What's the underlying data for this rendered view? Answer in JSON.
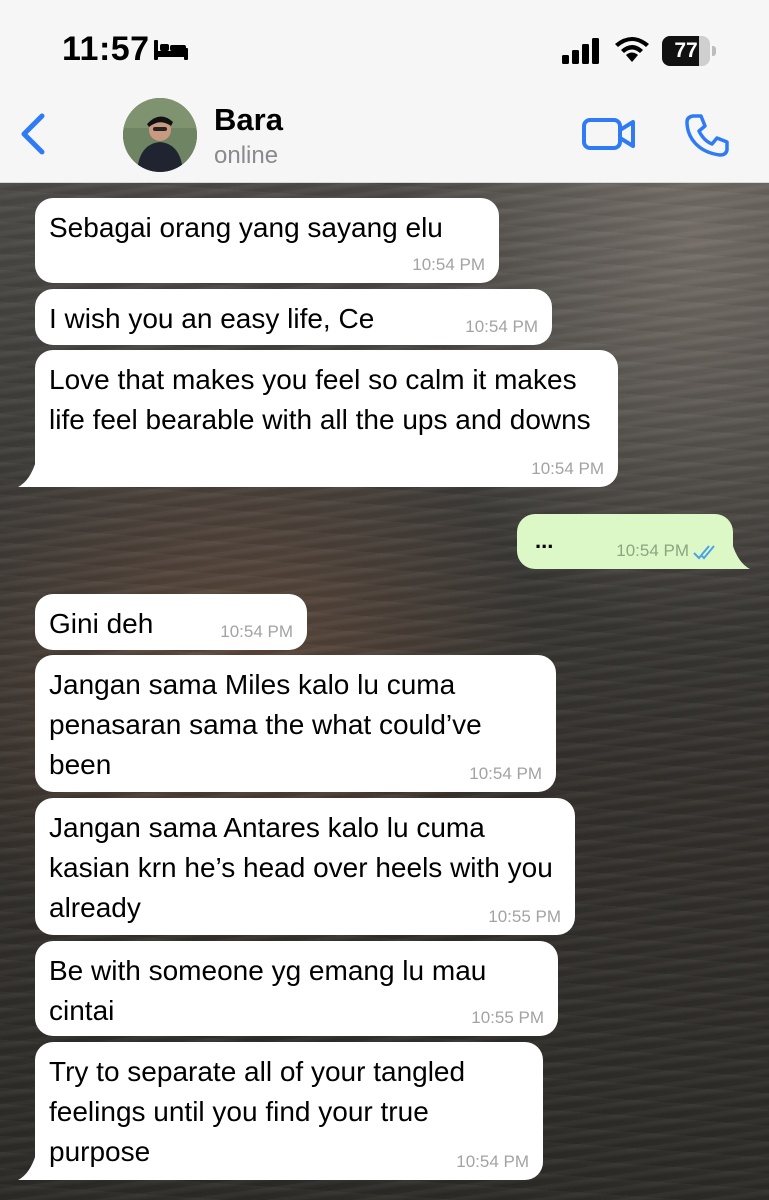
{
  "status_bar": {
    "time": "11:57",
    "battery": "77",
    "battery_level": 0.77
  },
  "header": {
    "contact_name": "Bara",
    "contact_status": "online",
    "accent_color": "#2f7bf6"
  },
  "messages": [
    {
      "direction": "in",
      "text": "Sebagai orang yang sayang elu",
      "time": "10:54 PM"
    },
    {
      "direction": "in",
      "text": "I wish you an easy life, Ce",
      "time": "10:54 PM"
    },
    {
      "direction": "in",
      "text": "Love that makes you feel so calm it makes life feel bearable with all the ups and downs",
      "time": "10:54 PM"
    },
    {
      "direction": "out",
      "text": "...",
      "time": "10:54 PM",
      "read": true
    },
    {
      "direction": "in",
      "text": "Gini deh",
      "time": "10:54 PM"
    },
    {
      "direction": "in",
      "text": "Jangan sama Miles kalo lu cuma penasaran sama the what could’ve been",
      "time": "10:54 PM"
    },
    {
      "direction": "in",
      "text": "Jangan sama Antares kalo lu cuma kasian krn he’s head over heels with you already",
      "time": "10:55 PM"
    },
    {
      "direction": "in",
      "text": "Be with someone yg emang lu mau cintai",
      "time": "10:55 PM"
    },
    {
      "direction": "in",
      "text": "Try to separate all of your tangled feelings until you find your true purpose",
      "time": "10:54 PM"
    }
  ]
}
